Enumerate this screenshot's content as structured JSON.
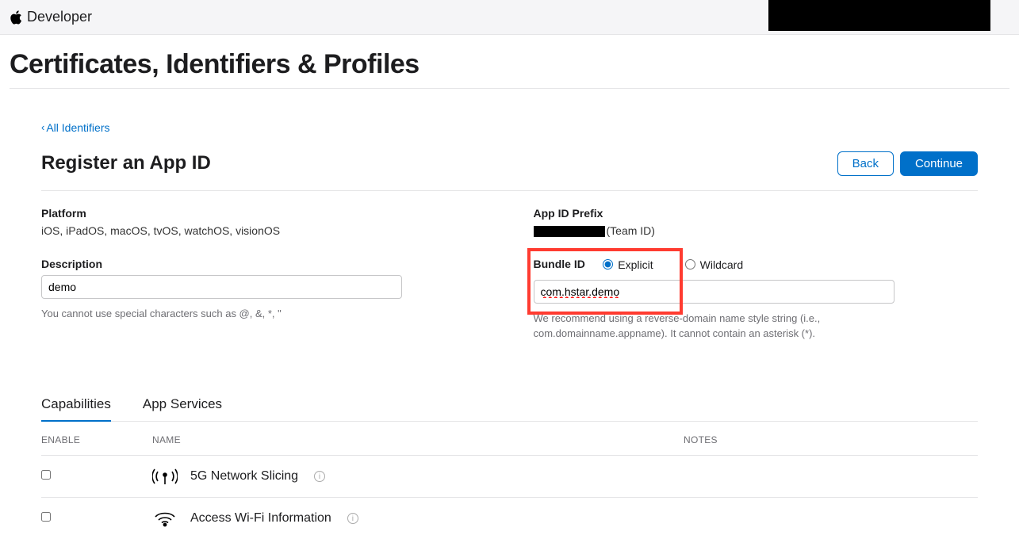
{
  "brand": "Developer",
  "page_title": "Certificates, Identifiers & Profiles",
  "back_link": "All Identifiers",
  "subheader": "Register an App ID",
  "buttons": {
    "back": "Back",
    "continue": "Continue"
  },
  "platform": {
    "label": "Platform",
    "value": "iOS, iPadOS, macOS, tvOS, watchOS, visionOS"
  },
  "app_id_prefix": {
    "label": "App ID Prefix",
    "suffix": "(Team ID)"
  },
  "description": {
    "label": "Description",
    "value": "demo",
    "help": "You cannot use special characters such as @, &, *, \""
  },
  "bundle_id": {
    "label": "Bundle ID",
    "options": {
      "explicit": "Explicit",
      "wildcard": "Wildcard"
    },
    "value": "com.hstar.demo",
    "help": "We recommend using a reverse-domain name style string (i.e., com.domainname.appname). It cannot contain an asterisk (*)."
  },
  "tabs": {
    "capabilities": "Capabilities",
    "app_services": "App Services"
  },
  "cap_table": {
    "head": {
      "enable": "ENABLE",
      "name": "NAME",
      "notes": "NOTES"
    },
    "rows": [
      {
        "name": "5G Network Slicing"
      },
      {
        "name": "Access Wi-Fi Information"
      }
    ]
  }
}
